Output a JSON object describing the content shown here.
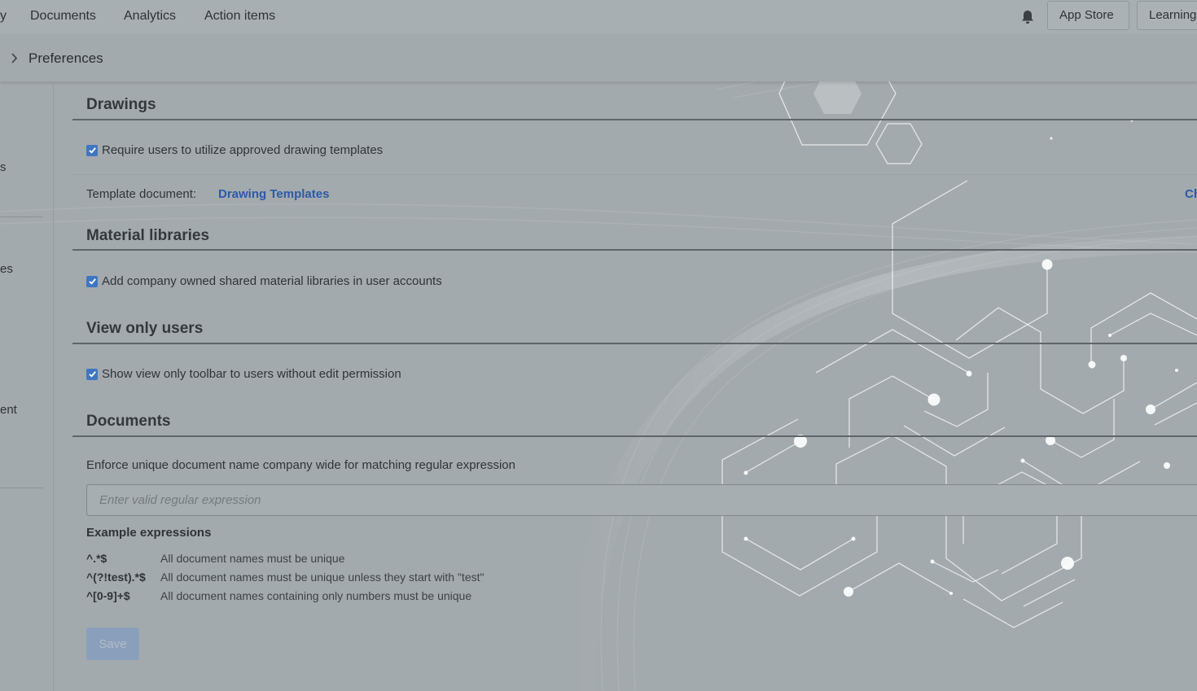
{
  "topnav": {
    "items": [
      {
        "label": "y"
      },
      {
        "label": "Documents"
      },
      {
        "label": "Analytics"
      },
      {
        "label": "Action items"
      }
    ],
    "app_store": "App Store",
    "learning": "Learning"
  },
  "breadcrumb": {
    "current": "Preferences"
  },
  "sidebar": {
    "fragments": [
      "s",
      "es",
      "ent"
    ]
  },
  "drawings": {
    "title": "Drawings",
    "require_templates": {
      "label": "Require users to utilize approved drawing templates",
      "checked": true
    },
    "template_label": "Template document:",
    "template_link": "Drawing Templates",
    "change_link": "Ch"
  },
  "material_libraries": {
    "title": "Material libraries",
    "add_shared": {
      "label": "Add company owned shared material libraries in user accounts",
      "checked": true
    }
  },
  "view_only": {
    "title": "View only users",
    "show_toolbar": {
      "label": "Show view only toolbar to users without edit permission",
      "checked": true
    }
  },
  "documents": {
    "title": "Documents",
    "enforce_label": "Enforce unique document name company wide for matching regular expression",
    "regex_placeholder": "Enter valid regular expression",
    "examples_title": "Example expressions",
    "examples": [
      {
        "code": "^.*$",
        "desc": "All document names must be unique"
      },
      {
        "code": "^(?!test).*$",
        "desc": "All document names must be unique unless they start with \"test\""
      },
      {
        "code": "^[0-9]+$",
        "desc": "All document names containing only numbers must be unique"
      }
    ],
    "save_label": "Save"
  },
  "colors": {
    "accent": "#3f76c2",
    "link": "#2c5aa8",
    "overlay": "#a3aaad"
  },
  "icons": {
    "bell": "bell-icon",
    "chevron": "chevron-right-icon",
    "check": "check-icon"
  }
}
